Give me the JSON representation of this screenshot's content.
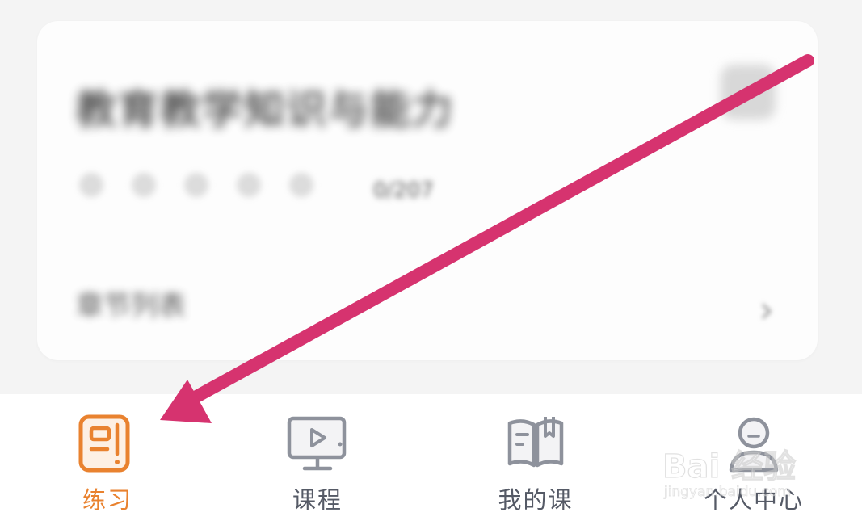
{
  "card": {
    "title": "教育教学知识与能力",
    "score": "0/207",
    "row_label": "章节列表",
    "chevron": "›"
  },
  "tabbar": {
    "tabs": [
      {
        "label": "练习",
        "icon": "practice-icon",
        "active": true
      },
      {
        "label": "课程",
        "icon": "video-course-icon",
        "active": false
      },
      {
        "label": "我的课",
        "icon": "book-icon",
        "active": false
      },
      {
        "label": "个人中心",
        "icon": "profile-icon",
        "active": false
      }
    ]
  },
  "watermark": {
    "main": "Bai 经验",
    "sub": "jingyan.baidu.com"
  },
  "colors": {
    "active": "#e9822f",
    "inactive": "#8e929c",
    "arrow": "#d6336f"
  }
}
